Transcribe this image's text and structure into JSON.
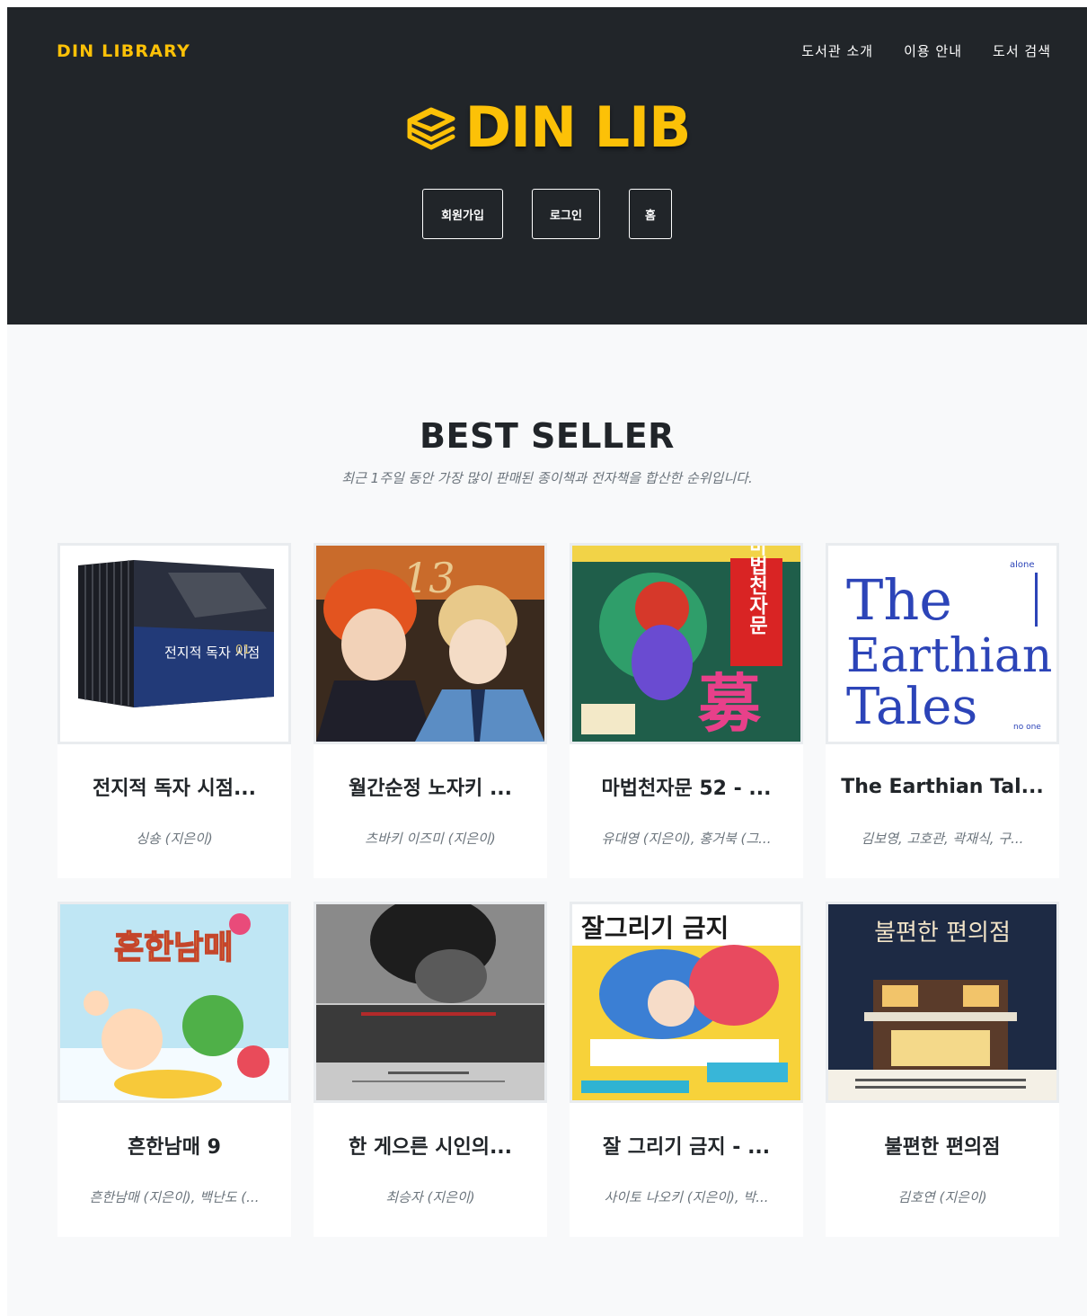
{
  "brand": "DIN LIBRARY",
  "nav": [
    {
      "label": "도서관 소개"
    },
    {
      "label": "이용 안내"
    },
    {
      "label": "도서 검색"
    }
  ],
  "logo": {
    "text": "DIN LIB",
    "icon": "book-stack-icon"
  },
  "hero_buttons": [
    {
      "label": "회원가입"
    },
    {
      "label": "로그인"
    },
    {
      "label": "홈"
    }
  ],
  "section": {
    "title": "BEST SELLER",
    "subtitle": "최근 1주일 동안 가장 많이 판매된 종이책과 전자책을 합산한 순위입니다."
  },
  "books": [
    {
      "title": "전지적 독자 시점...",
      "author": "싱숑 (지은이)",
      "cover_text": "전지적 독자 시점"
    },
    {
      "title": "월간순정 노자키 ...",
      "author": "츠바키 이즈미 (지은이)",
      "cover_text": "13"
    },
    {
      "title": "마법천자문 52 - ...",
      "author": "유대영 (지은이), 홍거북 (그...",
      "cover_text": "마법천자문"
    },
    {
      "title": "The Earthian Tal...",
      "author": "김보영, 고호관, 곽재식, 구...",
      "cover_text": "The Earthian Tales"
    },
    {
      "title": "흔한남매 9",
      "author": "흔한남매 (지은이), 백난도 (...",
      "cover_text": "흔한남매"
    },
    {
      "title": "한 게으른 시인의...",
      "author": "최승자 (지은이)",
      "cover_text": ""
    },
    {
      "title": "잘 그리기 금지 - ...",
      "author": "사이토 나오키 (지은이), 박...",
      "cover_text": "잘그리기 금지"
    },
    {
      "title": "불편한 편의점",
      "author": "김호연 (지은이)",
      "cover_text": "불편한 편의점"
    }
  ],
  "colors": {
    "accent": "#fcc107",
    "header_bg": "#212529",
    "page_bg": "#f8f9fa"
  }
}
